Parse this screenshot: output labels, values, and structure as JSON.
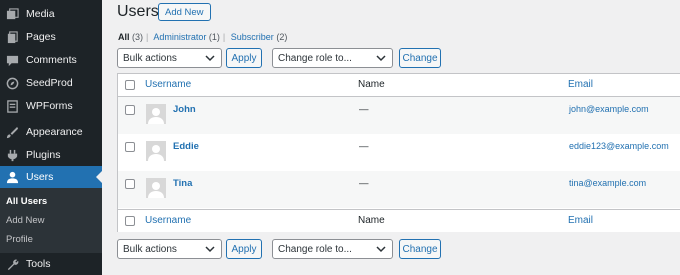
{
  "sidebar": {
    "items": [
      {
        "label": "Media",
        "icon": "media-icon"
      },
      {
        "label": "Pages",
        "icon": "pages-icon"
      },
      {
        "label": "Comments",
        "icon": "comments-icon"
      },
      {
        "label": "SeedProd",
        "icon": "seedprod-icon"
      },
      {
        "label": "WPForms",
        "icon": "wpforms-icon"
      },
      {
        "label": "Appearance",
        "icon": "appearance-icon"
      },
      {
        "label": "Plugins",
        "icon": "plugins-icon"
      },
      {
        "label": "Users",
        "icon": "users-icon"
      },
      {
        "label": "Tools",
        "icon": "tools-icon"
      }
    ],
    "submenu": [
      "All Users",
      "Add New",
      "Profile"
    ]
  },
  "header": {
    "title": "Users",
    "add_new": "Add New"
  },
  "filters": {
    "all": "All",
    "all_count": "(3)",
    "administrator": "Administrator",
    "administrator_count": "(1)",
    "subscriber": "Subscriber",
    "subscriber_count": "(2)",
    "separator": "|"
  },
  "actions_top": {
    "bulk": "Bulk actions",
    "apply": "Apply",
    "role": "Change role to...",
    "change": "Change"
  },
  "actions_bottom": {
    "bulk": "Bulk actions",
    "apply": "Apply",
    "role": "Change role to...",
    "change": "Change"
  },
  "table": {
    "columns": [
      "Username",
      "Name",
      "Email"
    ],
    "rows": [
      {
        "username": "John",
        "name": "—",
        "email": "john@example.com"
      },
      {
        "username": "Eddie",
        "name": "—",
        "email": "eddie123@example.com"
      },
      {
        "username": "Tina",
        "name": "—",
        "email": "tina@example.com"
      }
    ]
  },
  "colors": {
    "sidebar_bg": "#1d2327",
    "accent": "#2271b1",
    "page_bg": "#f0f0f1"
  }
}
